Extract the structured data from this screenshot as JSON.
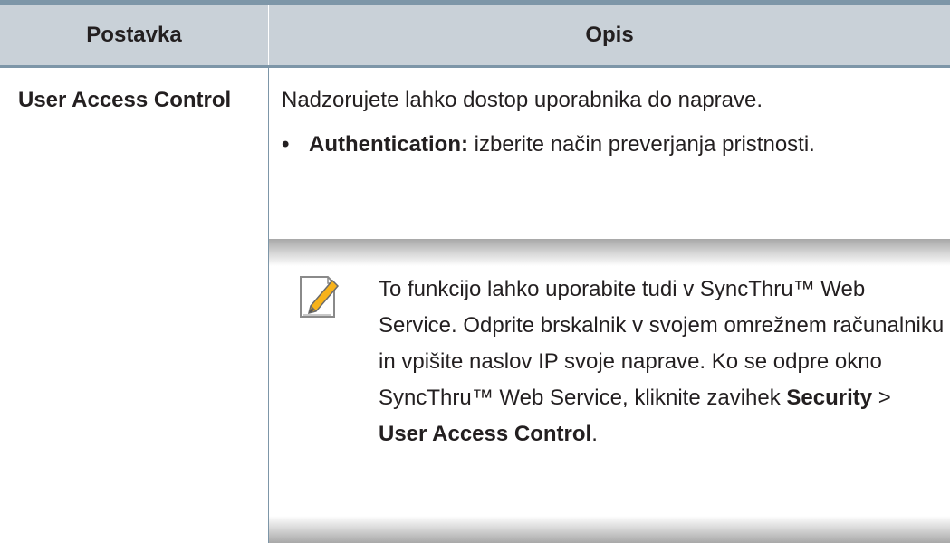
{
  "table": {
    "header": {
      "setting": "Postavka",
      "description": "Opis"
    },
    "row": {
      "setting": "User Access Control",
      "intro": "Nadzorujete lahko dostop uporabnika do naprave.",
      "bullet": {
        "term": "Authentication:",
        "text": " izberite način preverjanja pristnosti."
      },
      "note": {
        "icon": "note-pencil-icon",
        "text_1": "To funkcijo lahko uporabite tudi v SyncThru™ Web Service. Odprite brskalnik v svojem omrežnem računalniku in vpišite naslov IP svoje naprave. Ko se odpre okno SyncThru™ Web Service, kliknite zavihek ",
        "bold_1": "Security",
        "sep": " > ",
        "bold_2": "User Access Control",
        "end": "."
      }
    }
  },
  "colors": {
    "rule": "#7d96a8",
    "header_bg": "#c9d1d8",
    "accent_icon": "#f7b21b"
  }
}
